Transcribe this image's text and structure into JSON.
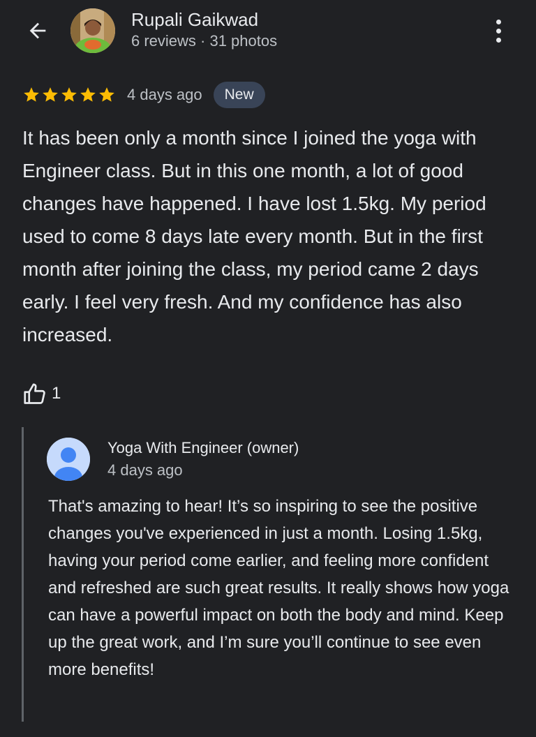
{
  "header": {
    "back_icon": "arrow-back-icon",
    "reviewer_name": "Rupali Gaikwad",
    "reviewer_meta": "6 reviews · 31 photos",
    "menu_icon": "more-vert-icon"
  },
  "review": {
    "rating": 5,
    "max_rating": 5,
    "star_color": "#fbbc04",
    "date": "4 days ago",
    "badge": "New",
    "text": "It has been only a month since I joined the yoga with Engineer class. But in this one month, a lot of good changes have happened. I have lost 1.5kg. My period used to come 8 days late every month. But in the first month after joining the class, my period came 2 days early. I feel very fresh. And my confidence has also increased.",
    "like_icon": "thumb-up-icon",
    "like_count": "1"
  },
  "owner_reply": {
    "name": "Yoga With Engineer (owner)",
    "date": "4 days ago",
    "avatar_icon": "default-person-avatar-icon",
    "text": "That's amazing to hear! It’s so inspiring to see the positive changes you've experienced in just a month. Losing 1.5kg, having your period come earlier, and feeling more confident and refreshed are such great results. It really shows how yoga can have a powerful impact on both the body and mind. Keep up the great work, and I’m sure you’ll continue to see even more benefits!"
  },
  "colors": {
    "background": "#202124",
    "text_primary": "#e8eaed",
    "text_secondary": "#bdc1c6",
    "badge_bg": "#394457",
    "avatar_blue": "#4285f4"
  }
}
